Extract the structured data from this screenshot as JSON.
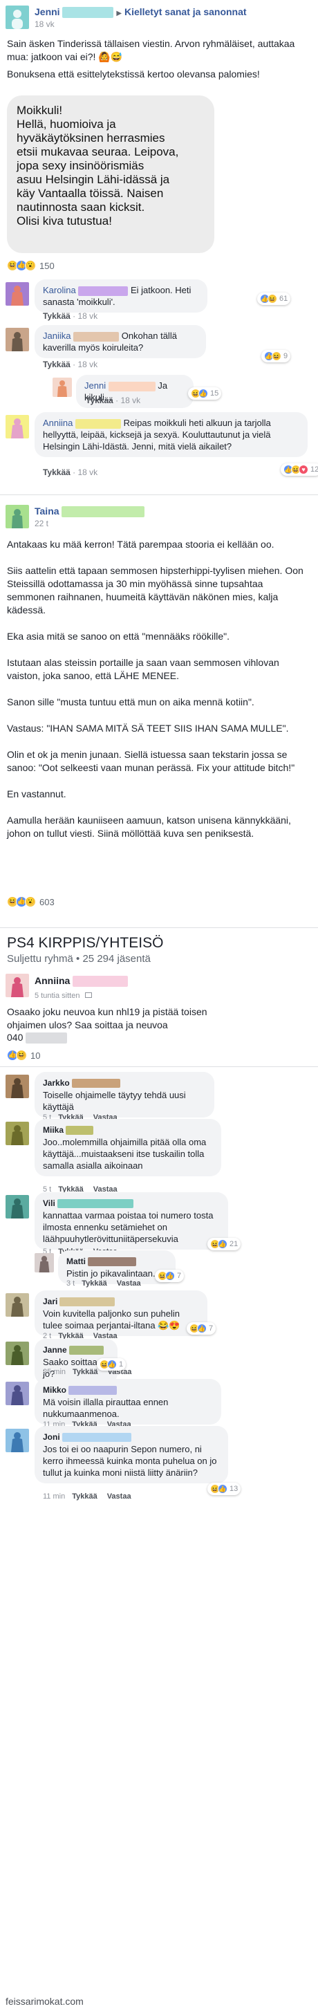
{
  "post1": {
    "author": "Jenni",
    "time": "18 vk",
    "group": "Kielletyt sanat ja sanonnat",
    "intro": "Sain äsken Tinderissä tällaisen viestin. Arvon ryhmäläiset, auttakaa mua: jatkoon vai ei?! 🙆😅",
    "bonus": "Bonuksena että esittelytekstissä kertoo olevansa palomies!",
    "quote": [
      "Moikkuli!",
      "Hellä, huomioiva ja",
      "hyväkäytöksinen herrasmies",
      "etsii mukavaa seuraa. Leipova,",
      "jopa sexy insinöörismiäs",
      "asuu Helsingin Lähi-idässä ja",
      "käy Vantaalla töissä.  Naisen",
      "nautinnosta saan kicksit.",
      "Olisi kiva tutustua!"
    ],
    "reactions_count": "150",
    "comments": [
      {
        "author": "Karolina",
        "text": "Ei jatkoon. Heti sanasta 'moikkuli'.",
        "like": "Tykkää",
        "time": "18 vk",
        "reactions": "61"
      },
      {
        "author": "Janiika",
        "text": "Onkohan tällä kaverilla myös koiruleita?",
        "like": "Tykkää",
        "time": "18 vk",
        "reactions": "9"
      },
      {
        "author": "Jenni",
        "text": "Ja kikuli...",
        "like": "Tykkää",
        "time": "18 vk",
        "reactions": "15"
      },
      {
        "author": "Anniina",
        "text": "Reipas moikkuli heti alkuun ja tarjolla hellyyttä, leipää, kicksejä ja sexyä. Kouluttautunut ja vielä Helsingin Lähi-Idästä. Jenni, mitä vielä aikailet?",
        "like": "Tykkää",
        "time": "18 vk",
        "reactions": "12"
      }
    ]
  },
  "post2": {
    "author": "Taina",
    "time": "22 t",
    "paragraphs": [
      "Antakaas ku mää kerron! Tätä parempaa stooria ei kellään oo.",
      "Siis aattelin että tapaan semmosen hipsterhippi-tyylisen miehen. Oon Steissillä odottamassa ja 30 min myöhässä sinne tupsahtaa semmonen raihnanen, huumeitä käyttävän näkönen mies, kalja kädessä.",
      "Eka asia mitä se sanoo on että \"mennääks röökille\".",
      "Istutaan alas steissin portaille ja saan vaan semmosen vihlovan vaiston, joka sanoo, että LÄHE MENEE.",
      "Sanon sille \"musta tuntuu että mun on aika mennä kotiin\".",
      "Vastaus: \"IHAN SAMA MITÄ SÄ TEET SIIS IHAN SAMA MULLE\".",
      "Olin et ok ja menin junaan. Siellä istuessa saan tekstarin jossa se sanoo: \"Oot selkeesti vaan munan perässä. Fix your attitude bitch!\"",
      "En vastannut.",
      "Aamulla herään kauniiseen aamuun, katson unisena kännykkääni, johon on tullut viesti. Siinä möllöttää kuva sen peniksestä."
    ],
    "reactions_count": "603"
  },
  "group": {
    "name": "PS4 KIRPPIS/YHTEISÖ",
    "subtitle": "Suljettu ryhmä • 25 294 jäsentä"
  },
  "post3": {
    "author": "Anniina",
    "time": "5 tuntia sitten",
    "text": "Osaako joku neuvoa kun nhl19 ja pistää toisen ohjaimen ulos? Saa soittaa ja neuvoa",
    "phone": "040",
    "reactions_count": "10",
    "comments": [
      {
        "author": "Jarkko",
        "text": "Toiselle ohjaimelle täytyy tehdä uusi käyttäjä",
        "time": "5 t",
        "like": "Tykkää",
        "reply": "Vastaa",
        "reactions": ""
      },
      {
        "author": "Miika",
        "text": "Joo..molemmilla ohjaimilla pitää olla oma käyttäjä...muistaakseni itse tuskailin tolla samalla asialla aikoinaan",
        "time": "5 t",
        "like": "Tykkää",
        "reply": "Vastaa",
        "reactions": ""
      },
      {
        "author": "Vili",
        "text": "kannattaa varmaa poistaa toi numero tosta ilmosta ennenku setämiehet on läähpuuhytlerövittuniitäpersekuvia",
        "time": "5 t",
        "like": "Tykkää",
        "reply": "Vastaa",
        "reactions": "21"
      },
      {
        "author": "Matti",
        "text": "Pistin jo pikavalintaan.",
        "time": "3 t",
        "like": "Tykkää",
        "reply": "Vastaa",
        "reactions": "7"
      },
      {
        "author": "Jari",
        "text": "Voin kuvitella paljonko sun puhelin tulee soimaa perjantai-iltana 😂😍",
        "time": "2 t",
        "like": "Tykkää",
        "reply": "Vastaa",
        "reactions": "7"
      },
      {
        "author": "Janne",
        "text": "Saako soittaa jo?",
        "time": "25 min",
        "like": "Tykkää",
        "reply": "Vastaa",
        "reactions": "1"
      },
      {
        "author": "Mikko",
        "text": "Mä voisin illalla pirauttaa ennen nukkumaanmenoa.",
        "time": "11 min",
        "like": "Tykkää",
        "reply": "Vastaa",
        "reactions": ""
      },
      {
        "author": "Joni",
        "text": "Jos toi ei oo naapurin Sepon numero, ni kerro ihmeessä kuinka monta puhelua on jo tullut ja kuinka moni niistä liitty änäriin?",
        "time": "11 min",
        "like": "Tykkää",
        "reply": "Vastaa",
        "reactions": "13"
      }
    ]
  },
  "watermark": "feissarimokat.com",
  "colors": {
    "link": "#365899",
    "bubble": "#f2f3f5",
    "divider": "#e9ebee",
    "meta": "#90949c"
  }
}
